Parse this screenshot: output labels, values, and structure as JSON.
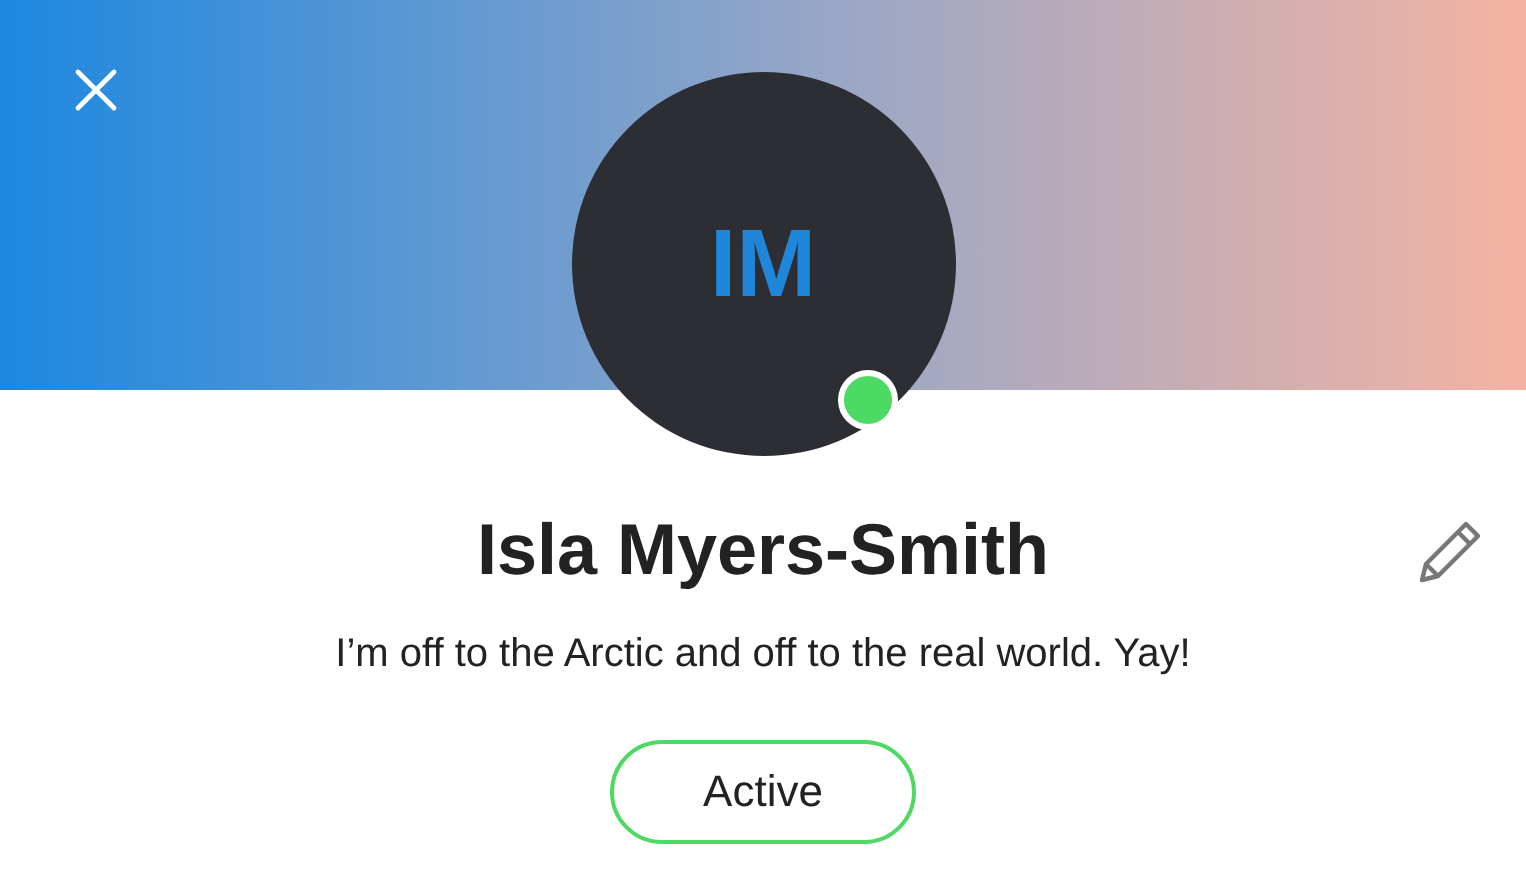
{
  "profile": {
    "initials": "IM",
    "online": true,
    "name": "Isla Myers-Smith",
    "status_message": "I’m off to the Arctic and off to the real world. Yay!"
  },
  "status_button": {
    "label": "Active"
  }
}
